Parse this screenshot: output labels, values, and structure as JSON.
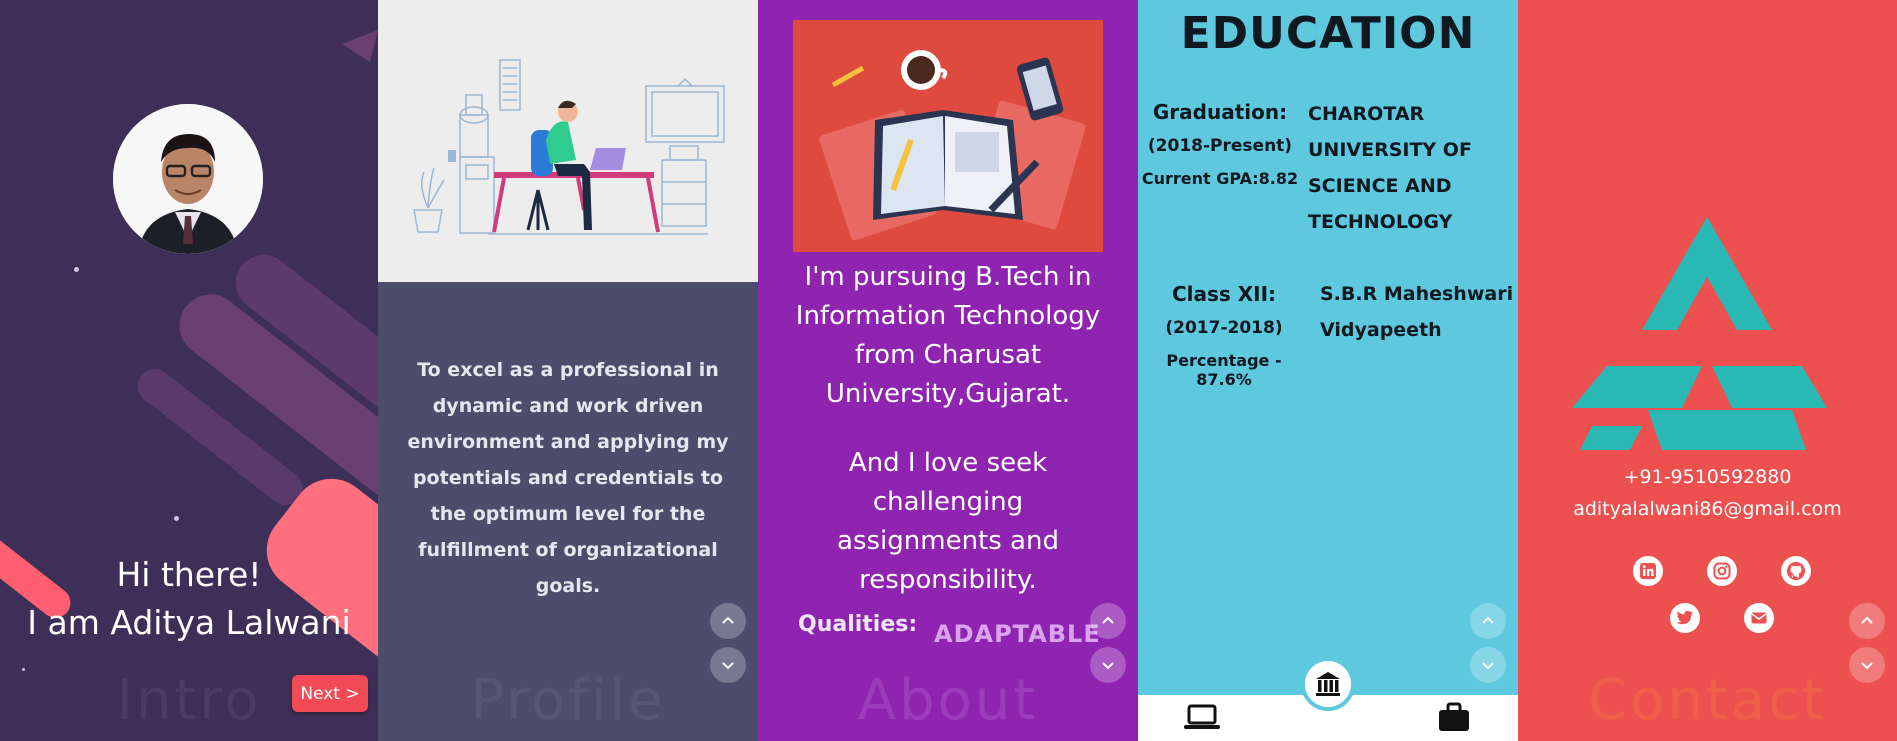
{
  "intro": {
    "greeting": "Hi there!",
    "name_line": "I am Aditya Lalwani",
    "next_label": "Next >",
    "watermark": "Intro"
  },
  "profile": {
    "objective": "To excel as a professional in dynamic and work driven environment and applying my potentials and credentials to the optimum level for the fulfillment of organizational goals.",
    "watermark": "Profile"
  },
  "about": {
    "paragraph1": "I'm pursuing B.Tech in Information Technology from Charusat University,Gujarat.",
    "paragraph2": "And I love seek challenging assignments and responsibility.",
    "qualities_label": "Qualities:",
    "quality_value": "ADAPTABLE",
    "watermark": "About"
  },
  "education": {
    "title": "EDUCATION",
    "entries": [
      {
        "level": "Graduation:",
        "period": "(2018-Present)",
        "score": "Current GPA:8.82",
        "institution_lines": [
          "CHAROTAR",
          "UNIVERSITY OF",
          "SCIENCE AND",
          "TECHNOLOGY"
        ]
      },
      {
        "level": "Class XII:",
        "period": "(2017-2018)",
        "score": "Percentage - 87.6%",
        "institution_lines": [
          "S.B.R Maheshwari",
          "Vidyapeeth"
        ]
      }
    ],
    "bottom_nav": [
      "laptop-icon",
      "bank-icon",
      "briefcase-icon"
    ]
  },
  "contact": {
    "phone": "+91-9510592880",
    "email": "adityalalwani86@gmail.com",
    "socials": [
      "linkedin-icon",
      "instagram-icon",
      "github-icon",
      "twitter-icon",
      "mail-icon"
    ],
    "watermark": "Contact"
  },
  "colors": {
    "intro_bg": "#3d2f57",
    "profile_bg": "#4b4d6b",
    "about_bg": "#8f24b0",
    "education_bg": "#5ec8df",
    "contact_bg": "#ec5150",
    "logo_teal": "#2ab9b4",
    "accent_coral": "#f24b55"
  }
}
